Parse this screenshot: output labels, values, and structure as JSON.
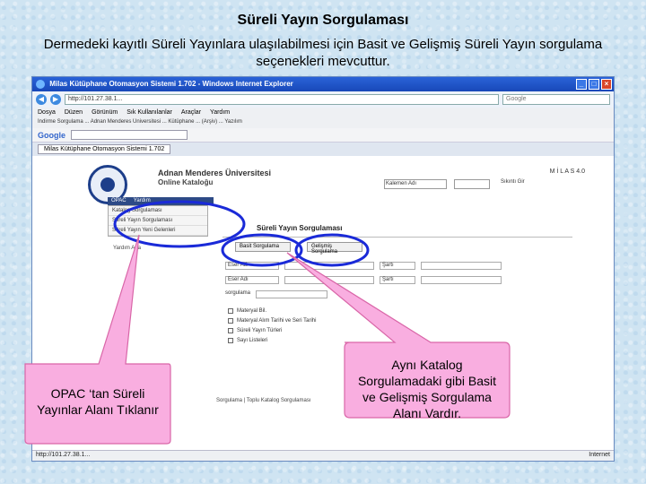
{
  "slide": {
    "title": "Süreli Yayın Sorgulaması",
    "subtitle": "Dermedeki kayıtlı Süreli Yayınlara ulaşılabilmesi için Basit ve Gelişmiş Süreli Yayın sorgulama seçenekleri mevcuttur."
  },
  "browser": {
    "window_title": "Milas Kütüphane Otomasyon Sistemi 1.702 - Windows Internet Explorer",
    "url": "http://101.27.38.1...",
    "search_placeholder": "Google",
    "menu": [
      "Dosya",
      "Düzen",
      "Görünüm",
      "Sık Kullanılanlar",
      "Araçlar",
      "Yardım"
    ],
    "links_text": "İndirme Sorgulama ... Adnan Menderes Üniversitesi ... Kütüphane ... (Arşiv) ... Yazılım",
    "google_label": "Google",
    "tab_label": "Milas Kütüphane Otomasyon Sistemi 1.702",
    "status_left": "http://101.27.38.1...",
    "status_right": "Internet"
  },
  "page": {
    "univ_name": "Adnan Menderes Üniversitesi",
    "catalog_name": "Online Kataloğu",
    "brand_right": "M İ L A S 4.0",
    "keyword_value": "Kalemen Adı",
    "search_button": "Sıkıntı Gir",
    "nav_opac": "OPAC",
    "nav_help": "Yardım",
    "dropdown_items": [
      "Katalog Sorgulaması",
      "Süreli Yayın Sorgulaması",
      "Süreli Yayın Yeni Gelenleri"
    ],
    "left_link": "Yardım Ana",
    "section_title": "Süreli Yayın Sorgulaması",
    "tab_basic": "Basit Sorgulama",
    "tab_advanced": "Gelişmiş Sorgulama",
    "field1": "Eser Adı",
    "field2": "Eser Adı",
    "op1": "Şartı",
    "op2": "Şartı",
    "sort_label": "sorgulama",
    "checks": [
      "Materyal Bil.",
      "Materyal Alım Tarihi ve Seri Tarihi",
      "Süreli Yayın Türleri",
      "Sayı Listeleri"
    ],
    "bottom_links": "Sorgulama | Toplu Katalog Sorgulaması"
  },
  "callouts": {
    "left": "OPAC ‘tan Süreli Yayınlar Alanı Tıklanır",
    "right": "Aynı Katalog Sorgulamadaki gibi  Basit ve Gelişmiş Sorgulama Alanı Vardır."
  },
  "colors": {
    "callout_fill": "#f9aee0",
    "callout_stroke": "#d966a8",
    "highlight_ellipse": "#1a2ad8"
  }
}
